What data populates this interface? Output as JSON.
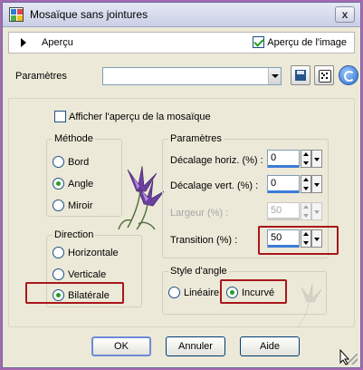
{
  "window": {
    "title": "Mosaïque sans jointures",
    "close_glyph": "x"
  },
  "preview": {
    "label": "Aperçu",
    "show_preview_label": "Aperçu de l'image",
    "show_preview_checked": true
  },
  "settings": {
    "label": "Paramètres",
    "preset_value": ""
  },
  "tile_preview": {
    "label": "Afficher l'aperçu de la mosaïque",
    "checked": false
  },
  "method": {
    "title": "Méthode",
    "options": [
      "Bord",
      "Angle",
      "Miroir"
    ],
    "selected": "Angle"
  },
  "direction": {
    "title": "Direction",
    "options": [
      "Horizontale",
      "Verticale",
      "Bilatérale"
    ],
    "selected": "Bilatérale"
  },
  "params": {
    "title": "Paramètres",
    "horiz_offset_label": "Décalage horiz. (%) :",
    "horiz_offset_value": "0",
    "vert_offset_label": "Décalage vert. (%) :",
    "vert_offset_value": "0",
    "width_label": "Largeur (%) :",
    "width_value": "50",
    "transition_label": "Transition (%) :",
    "transition_value": "50"
  },
  "corner_style": {
    "title": "Style d'angle",
    "options": [
      "Linéaire",
      "Incurvé"
    ],
    "selected": "Incurvé"
  },
  "buttons": {
    "ok": "OK",
    "cancel": "Annuler",
    "help": "Aide"
  },
  "colors": {
    "highlight": "#a8161c",
    "accent_green": "#21a121",
    "background": "#a56ab3"
  }
}
